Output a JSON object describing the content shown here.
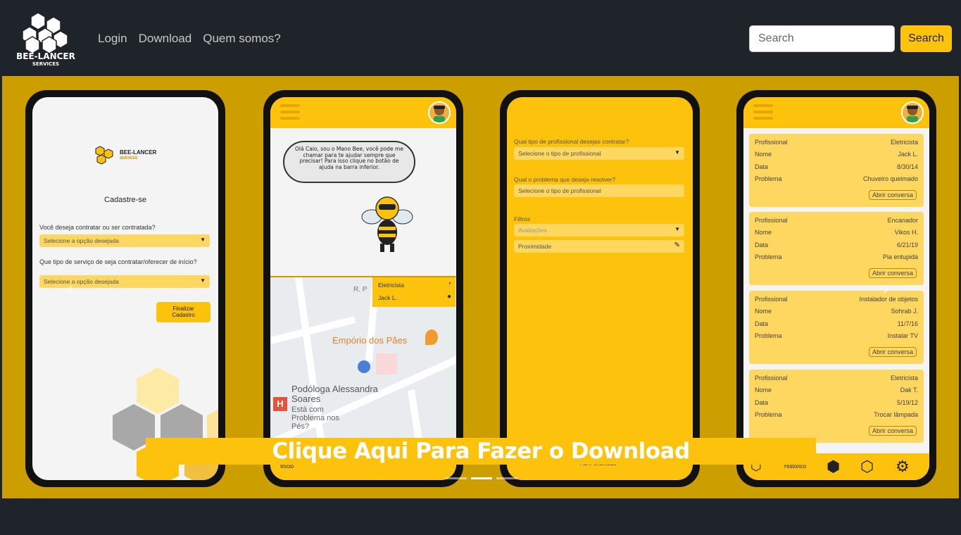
{
  "brand": {
    "name": "BEE-LANCER",
    "sub": "SERVICES"
  },
  "nav": {
    "links": [
      "Login",
      "Download",
      "Quem somos?"
    ]
  },
  "search": {
    "placeholder": "Search",
    "button": "Search"
  },
  "carousel": {
    "cta": "Clique Aqui Para Fazer o Download",
    "indicators": 3,
    "active_index": 1
  },
  "screen1": {
    "brand": "BEE-LANCER",
    "brand_sub": "SERVICES",
    "title": "Cadastre-se",
    "q1": "Você deseja contratar ou ser contratada?",
    "q1_select": "Selecione a opção desejada",
    "q2": "Que tipo de serviço de seja contratar/oferecer de início?",
    "q2_select": "Selecione a opção desejada",
    "finish_button": "Finalizar Cadastro"
  },
  "screen2": {
    "speech": "Olá Caio, sou o Mano Bee, você pode me chamar para te ajudar sempre que precisar! Para isso clique no botão de ajuda na barra inferior.",
    "popup_service": "Eletricista",
    "popup_name": "Jack L.",
    "map_place1": "Empório dos Pães",
    "map_place2": "Podóloga Alessandra Soares",
    "map_place2_sub": "Está com Problema nos Pés?",
    "map_street": "R. P",
    "nav_start": "Início"
  },
  "screen3": {
    "q1": "Qual tipo de profissional desejas contratar?",
    "q1_select": "Selecione o tipo de profissional",
    "q2": "Qual o problema que deseja resolver?",
    "q2_input": "Selecione o tipo de profissional",
    "filters": "Filtros",
    "filter1": "Avaliações",
    "filter2": "Proximidade",
    "nav_open": "Abrir chamado"
  },
  "screen4": {
    "labels": {
      "prof": "Profissional",
      "name": "Nome",
      "date": "Data",
      "problem": "Problema",
      "open": "Abrir conversa"
    },
    "cards": [
      {
        "prof": "Eletricista",
        "name": "Jack L.",
        "date": "8/30/14",
        "problem": "Chuveiro queimado"
      },
      {
        "prof": "Encanador",
        "name": "Vikos H.",
        "date": "6/21/19",
        "problem": "Pia entupida"
      },
      {
        "prof": "Instalador de objetos",
        "name": "Sohrab J.",
        "date": "11/7/16",
        "problem": "Instalar TV"
      },
      {
        "prof": "Eletricista",
        "name": "Dak T.",
        "date": "5/19/12",
        "problem": "Trocar lâmpada"
      }
    ],
    "nav_history": "Histórico"
  },
  "colors": {
    "accent": "#fdc30c",
    "navbar": "#1f232a",
    "carousel_bg": "#cc9e00",
    "card": "#fdd760"
  }
}
